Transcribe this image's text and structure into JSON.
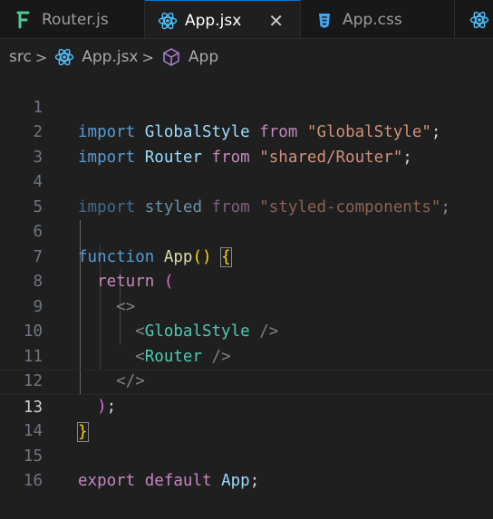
{
  "tabs": [
    {
      "label": "Router.js",
      "icon": "fork-icon",
      "active": false
    },
    {
      "label": "App.jsx",
      "icon": "react-icon",
      "active": true,
      "close": "✕"
    },
    {
      "label": "App.css",
      "icon": "css-icon",
      "active": false
    }
  ],
  "breadcrumb": {
    "folder": "src",
    "file": "App.jsx",
    "symbol": "App",
    "separator": ">"
  },
  "editor": {
    "current_line": 13,
    "lines": [
      {
        "n": "1"
      },
      {
        "n": "2"
      },
      {
        "n": "3"
      },
      {
        "n": "4"
      },
      {
        "n": "5"
      },
      {
        "n": "6"
      },
      {
        "n": "7"
      },
      {
        "n": "8"
      },
      {
        "n": "9"
      },
      {
        "n": "10"
      },
      {
        "n": "11"
      },
      {
        "n": "12"
      },
      {
        "n": "13"
      },
      {
        "n": "14"
      },
      {
        "n": "15"
      },
      {
        "n": "16"
      }
    ],
    "code": {
      "l1": {
        "kw": "import",
        "id": "GlobalStyle",
        "from": "from",
        "str": "\"GlobalStyle\"",
        "end": ";"
      },
      "l2": {
        "kw": "import",
        "id": "Router",
        "from": "from",
        "str": "\"shared/Router\"",
        "end": ";"
      },
      "l4": {
        "kw": "import",
        "id": "styled",
        "from": "from",
        "str": "\"styled-components\"",
        "end": ";"
      },
      "l6": {
        "kw": "function",
        "name": "App",
        "parens": "()",
        "brace": "{"
      },
      "l7": {
        "kw": "return",
        "paren": "("
      },
      "l8": {
        "tag": "<>"
      },
      "l9": {
        "open": "<",
        "comp": "GlobalStyle",
        "close": "/>"
      },
      "l10": {
        "open": "<",
        "comp": "Router",
        "close": "/>"
      },
      "l11": {
        "tag": "</>"
      },
      "l12": {
        "paren": ")",
        "end": ";"
      },
      "l13": {
        "brace": "}"
      },
      "l15": {
        "kw": "export",
        "kw2": "default",
        "id": "App",
        "end": ";"
      }
    }
  },
  "colors": {
    "accent": "#0078d4",
    "keyword": "#569cd6",
    "control": "#c586c0",
    "string": "#ce9178",
    "component": "#4ec9b0"
  }
}
